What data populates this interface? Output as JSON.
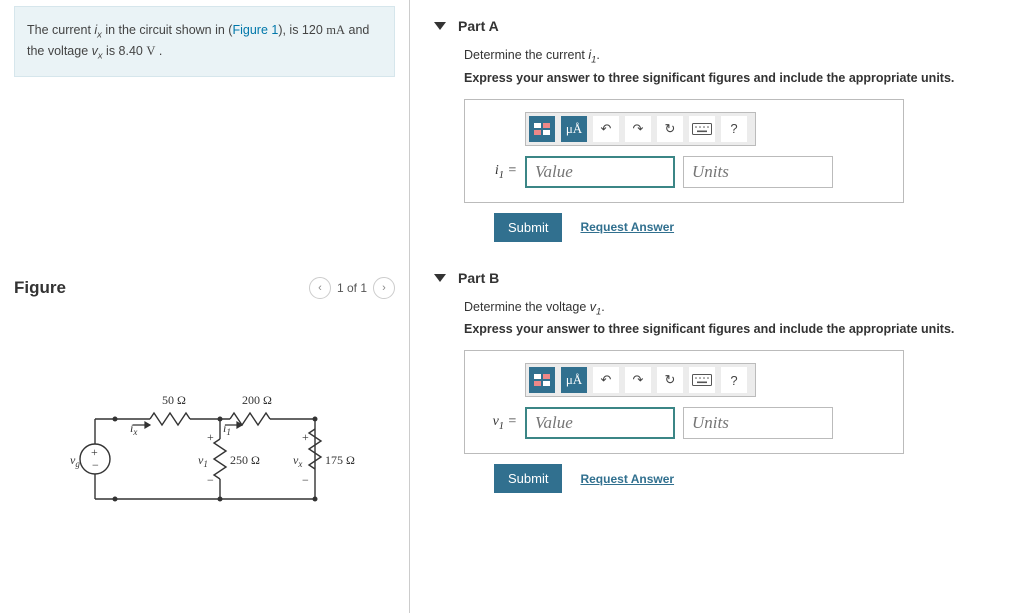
{
  "prompt": {
    "pre": "The current ",
    "ix": "i",
    "ix_sub": "x",
    "mid1": " in the circuit shown in (",
    "fig_link": "Figure 1",
    "mid2": "), is 120 ",
    "unit1": "mA",
    "mid3": " and the voltage ",
    "vx": "v",
    "vx_sub": "x",
    "mid4": " is 8.40 ",
    "unit2": "V",
    "end": " ."
  },
  "figure": {
    "title": "Figure",
    "pager": "1 of 1"
  },
  "circuit": {
    "r1": "50 Ω",
    "r2": "200 Ω",
    "r3": "250 Ω",
    "r4": "175 Ω",
    "vg": "v",
    "vg_sub": "g",
    "ix": "i",
    "ix_sub": "x",
    "i1": "i",
    "i1_sub": "1",
    "v1": "v",
    "v1_sub": "1",
    "vx": "v",
    "vx_sub": "x"
  },
  "parts": [
    {
      "title": "Part A",
      "determine_pre": "Determine the current ",
      "var": "i",
      "var_sub": "1",
      "var_post": ".",
      "instruct": "Express your answer to three significant figures and include the appropriate units.",
      "eq_label": "i",
      "eq_sub": "1",
      "value_ph": "Value",
      "units_ph": "Units",
      "submit": "Submit",
      "request": "Request Answer"
    },
    {
      "title": "Part B",
      "determine_pre": "Determine the voltage ",
      "var": "v",
      "var_sub": "1",
      "var_post": ".",
      "instruct": "Express your answer to three significant figures and include the appropriate units.",
      "eq_label": "v",
      "eq_sub": "1",
      "value_ph": "Value",
      "units_ph": "Units",
      "submit": "Submit",
      "request": "Request Answer"
    }
  ],
  "toolbar": {
    "mu": "μÅ",
    "help": "?"
  }
}
